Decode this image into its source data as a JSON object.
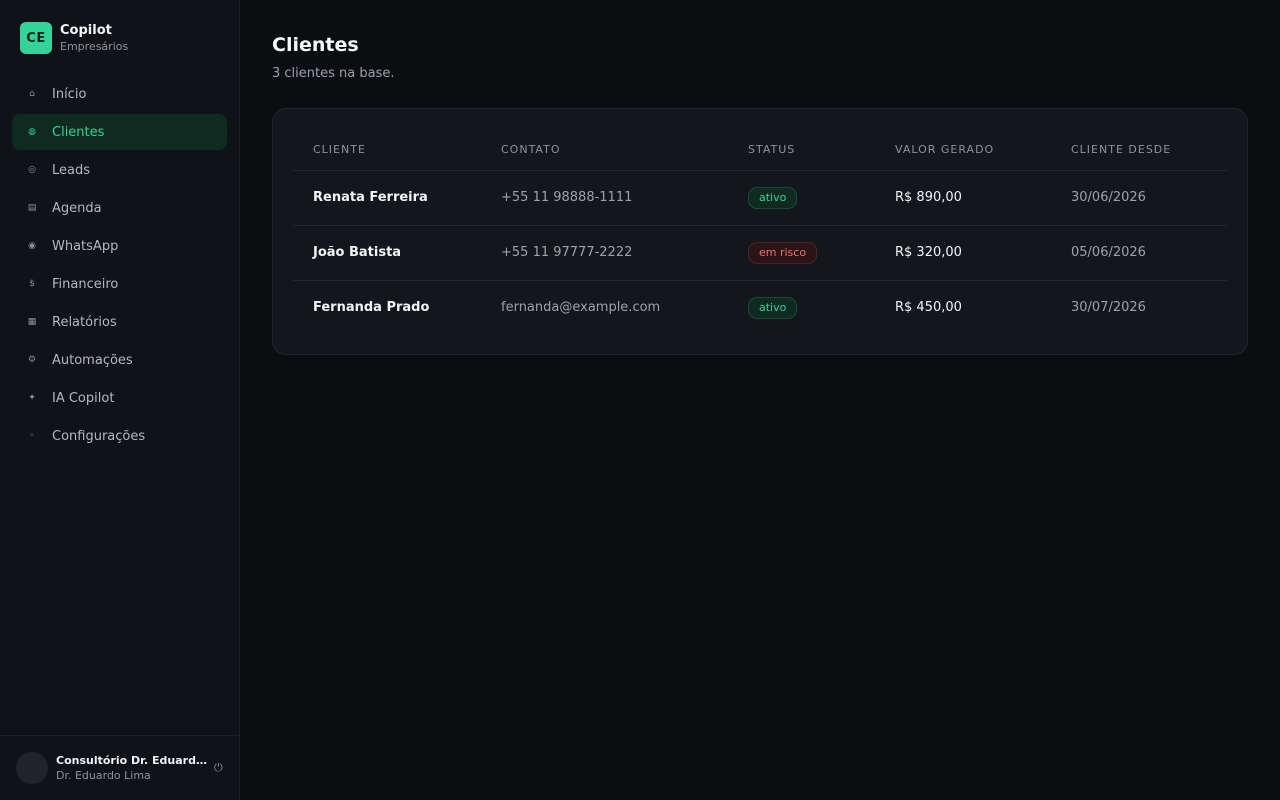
{
  "brand": {
    "logo": "CE",
    "name": "Copilot",
    "subtitle": "Empresários"
  },
  "sidebar": {
    "items": [
      {
        "label": "Início",
        "icon": "home-icon",
        "glyph": "⌂",
        "active": false
      },
      {
        "label": "Clientes",
        "icon": "globe-icon",
        "glyph": "◍",
        "active": true
      },
      {
        "label": "Leads",
        "icon": "target-icon",
        "glyph": "◎",
        "active": false
      },
      {
        "label": "Agenda",
        "icon": "calendar-icon",
        "glyph": "▤",
        "active": false
      },
      {
        "label": "WhatsApp",
        "icon": "chat-icon",
        "glyph": "◉",
        "active": false
      },
      {
        "label": "Financeiro",
        "icon": "dollar-icon",
        "glyph": "$",
        "active": false
      },
      {
        "label": "Relatórios",
        "icon": "report-icon",
        "glyph": "▦",
        "active": false
      },
      {
        "label": "Automações",
        "icon": "gear-icon",
        "glyph": "⚙",
        "active": false
      },
      {
        "label": "IA Copilot",
        "icon": "sparkle-icon",
        "glyph": "✦",
        "active": false
      },
      {
        "label": "Configurações",
        "icon": "settings-icon",
        "glyph": "◦",
        "active": false
      }
    ]
  },
  "account": {
    "name": "Consultório Dr. Eduardo Lima",
    "user": "Dr. Eduardo Lima",
    "power_glyph": "⏻"
  },
  "page": {
    "title": "Clientes",
    "subtitle": "3 clientes na base."
  },
  "table": {
    "headers": [
      "CLIENTE",
      "CONTATO",
      "STATUS",
      "VALOR GERADO",
      "CLIENTE DESDE"
    ],
    "rows": [
      {
        "name": "Renata Ferreira",
        "contact": "+55 11 98888-1111",
        "status": "ativo",
        "value": "R$ 890,00",
        "since": "30/06/2026"
      },
      {
        "name": "João Batista",
        "contact": "+55 11 97777-2222",
        "status": "em risco",
        "value": "R$ 320,00",
        "since": "05/06/2026"
      },
      {
        "name": "Fernanda Prado",
        "contact": "fernanda@example.com",
        "status": "ativo",
        "value": "R$ 450,00",
        "since": "30/07/2026"
      }
    ]
  },
  "colors": {
    "accent": "#34d399",
    "risk": "#f26d6d",
    "background": "#0b0d11"
  }
}
